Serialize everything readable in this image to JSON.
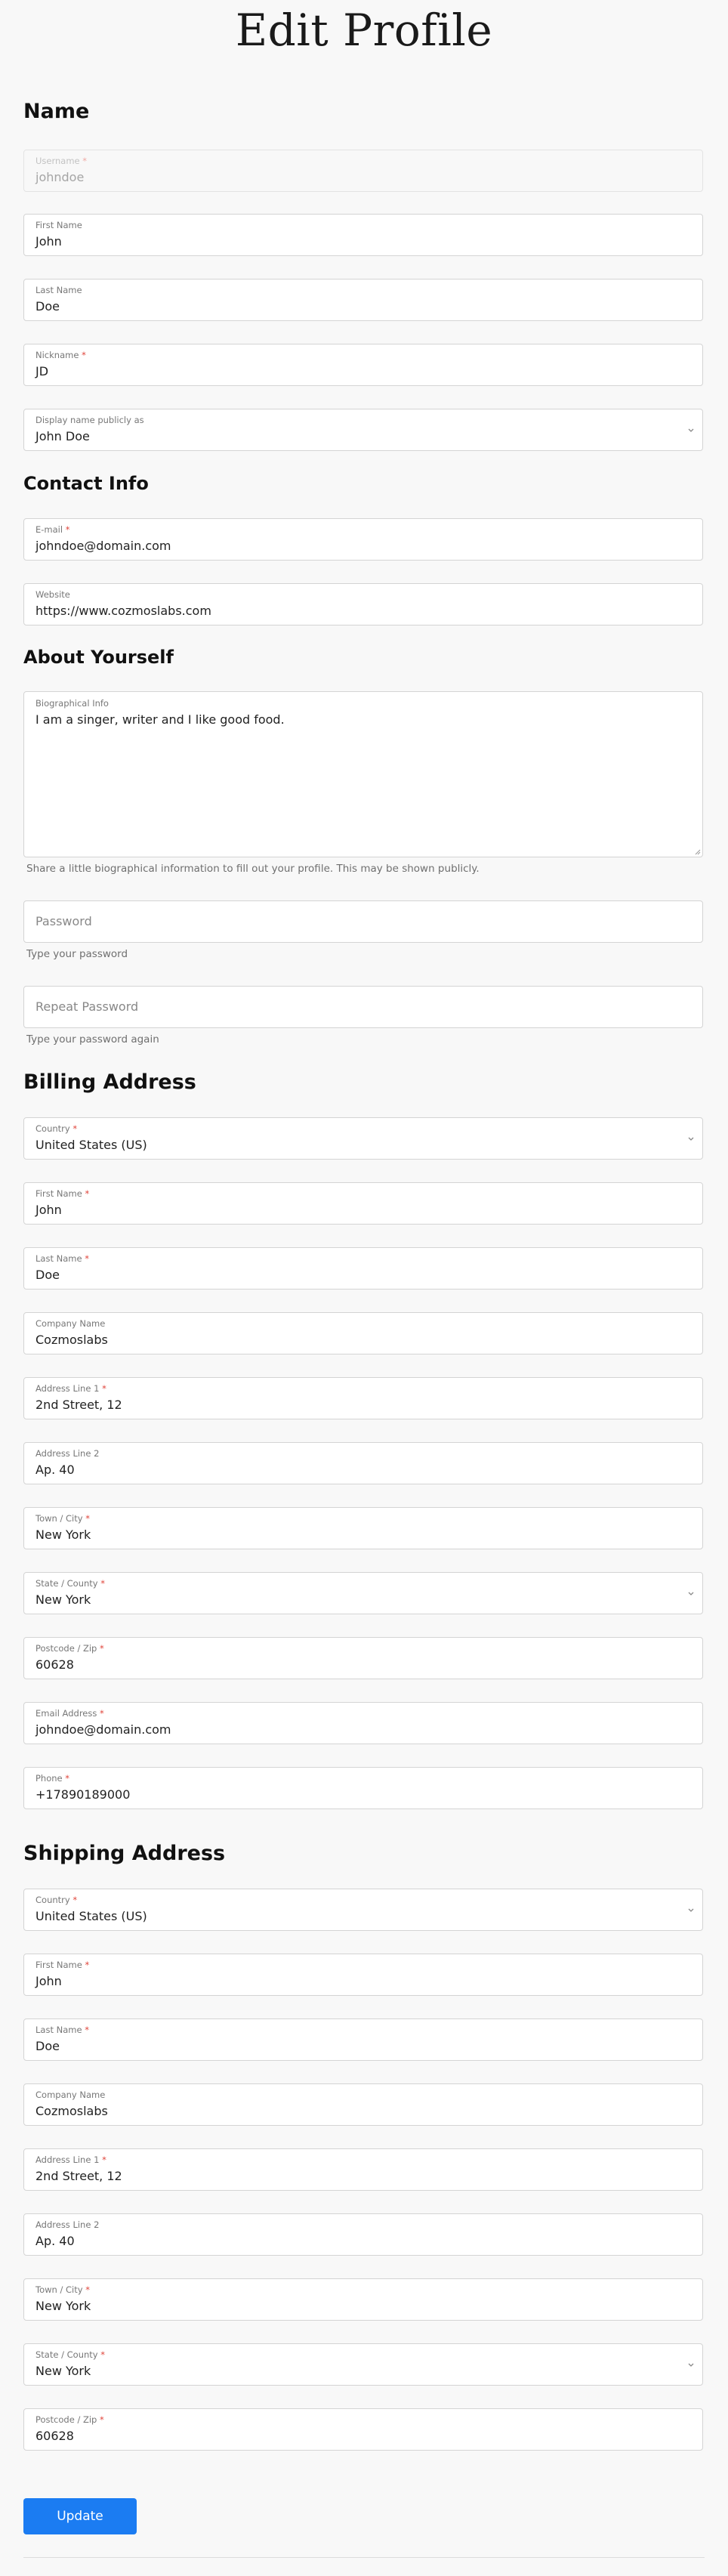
{
  "page": {
    "title": "Edit Profile"
  },
  "name_section": {
    "heading": "Name",
    "username": {
      "label": "Username",
      "value": "johndoe"
    },
    "first_name": {
      "label": "First Name",
      "value": "John"
    },
    "last_name": {
      "label": "Last Name",
      "value": "Doe"
    },
    "nickname": {
      "label": "Nickname",
      "value": "JD"
    },
    "display_name": {
      "label": "Display name publicly as",
      "value": "John Doe"
    }
  },
  "contact_section": {
    "heading": "Contact Info",
    "email": {
      "label": "E-mail",
      "value": "johndoe@domain.com"
    },
    "website": {
      "label": "Website",
      "value": "https://www.cozmoslabs.com"
    }
  },
  "about_section": {
    "heading": "About Yourself",
    "bio": {
      "label": "Biographical Info",
      "value": "I am a singer, writer and I like good food."
    },
    "bio_hint": "Share a little biographical information to fill out your profile. This may be shown publicly.",
    "password": {
      "placeholder": "Password",
      "hint": "Type your password"
    },
    "repeat_password": {
      "placeholder": "Repeat Password",
      "hint": "Type your password again"
    }
  },
  "billing_section": {
    "heading": "Billing Address",
    "country": {
      "label": "Country",
      "value": "United States (US)"
    },
    "first_name": {
      "label": "First Name",
      "value": "John"
    },
    "last_name": {
      "label": "Last Name",
      "value": "Doe"
    },
    "company": {
      "label": "Company Name",
      "value": "Cozmoslabs"
    },
    "address1": {
      "label": "Address Line 1",
      "value": "2nd Street, 12"
    },
    "address2": {
      "label": "Address Line 2",
      "value": "Ap. 40"
    },
    "city": {
      "label": "Town / City",
      "value": "New York"
    },
    "state": {
      "label": "State / County",
      "value": "New York"
    },
    "postcode": {
      "label": "Postcode / Zip",
      "value": "60628"
    },
    "email": {
      "label": "Email Address",
      "value": "johndoe@domain.com"
    },
    "phone": {
      "label": "Phone",
      "value": "+17890189000"
    }
  },
  "shipping_section": {
    "heading": "Shipping Address",
    "country": {
      "label": "Country",
      "value": "United States (US)"
    },
    "first_name": {
      "label": "First Name",
      "value": "John"
    },
    "last_name": {
      "label": "Last Name",
      "value": "Doe"
    },
    "company": {
      "label": "Company Name",
      "value": "Cozmoslabs"
    },
    "address1": {
      "label": "Address Line 1",
      "value": "2nd Street, 12"
    },
    "address2": {
      "label": "Address Line 2",
      "value": "Ap. 40"
    },
    "city": {
      "label": "Town / City",
      "value": "New York"
    },
    "state": {
      "label": "State / County",
      "value": "New York"
    },
    "postcode": {
      "label": "Postcode / Zip",
      "value": "60628"
    }
  },
  "actions": {
    "update_label": "Update"
  },
  "required_marker": "*",
  "colors": {
    "accent": "#1b7cf2",
    "required": "#e0443a",
    "background": "#f8f8f8",
    "field_border": "#d4d4d4"
  }
}
